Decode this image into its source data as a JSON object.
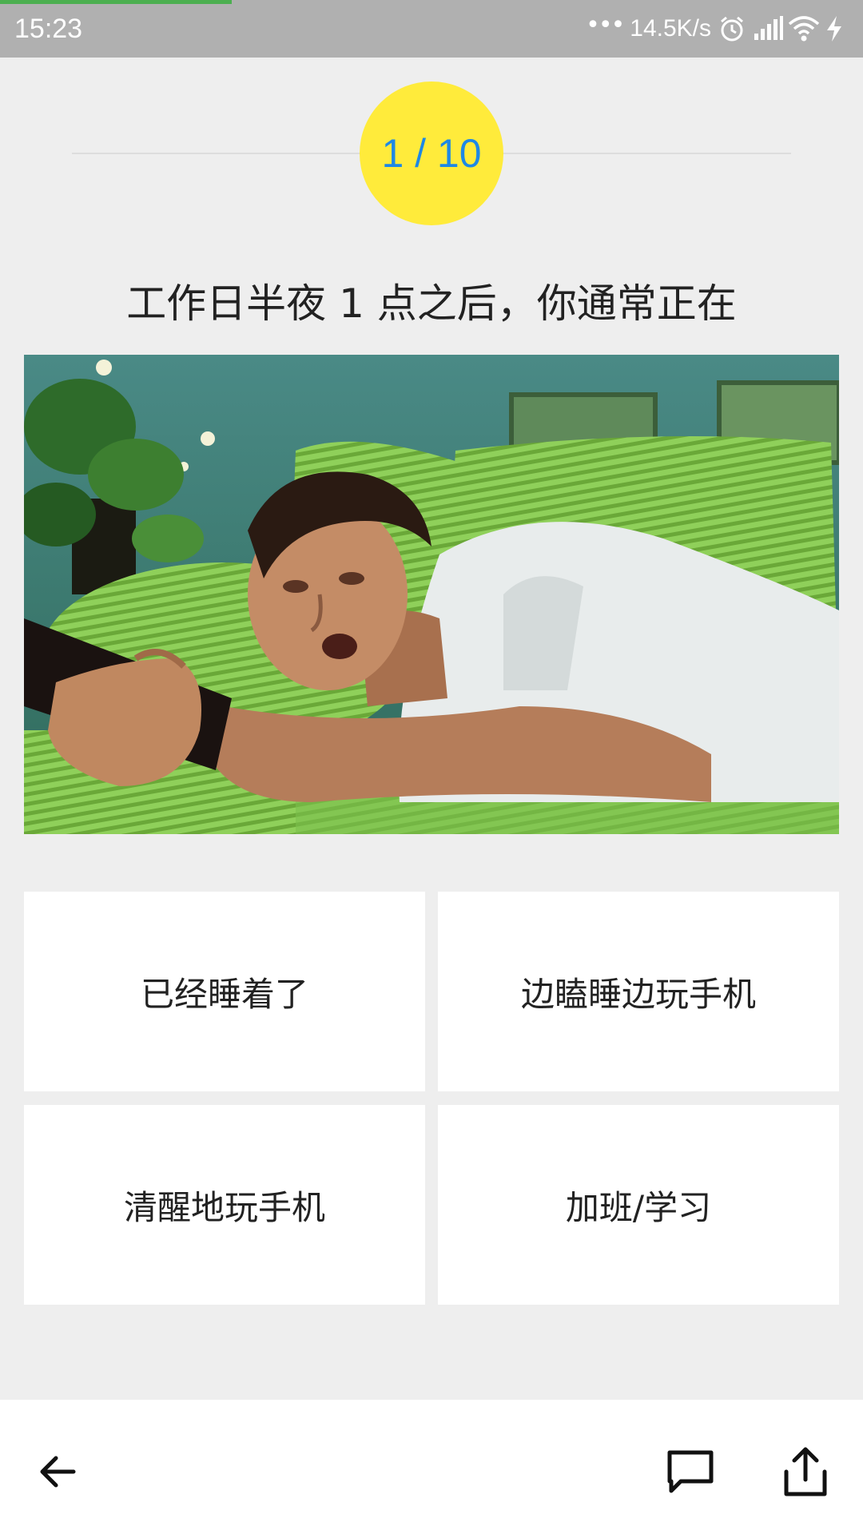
{
  "status_bar": {
    "time": "15:23",
    "dots": "•••",
    "network_speed": "14.5K/s",
    "icons": [
      "alarm-icon",
      "signal-icon",
      "wifi-icon",
      "charging-icon"
    ],
    "page_load_progress": 0.27,
    "progress_color": "#4caf50"
  },
  "quiz": {
    "progress_text": "1 / 10",
    "current": 1,
    "total": 10,
    "question": "工作日半夜 1 点之后，你通常正在",
    "image_description_icon": "man-lying-on-sofa-with-remote-image",
    "answers": [
      {
        "label": "已经睡着了"
      },
      {
        "label": "边瞌睡边玩手机"
      },
      {
        "label": "清醒地玩手机"
      },
      {
        "label": "加班/学习"
      }
    ]
  },
  "bottom_bar": {
    "icons": [
      "back-arrow-icon",
      "comment-icon",
      "share-icon"
    ]
  },
  "colors": {
    "accent_circle": "#ffeb3b",
    "progress_text": "#1e88e5",
    "page_background": "#eeeeee",
    "status_bar": "#b0b0b0"
  }
}
